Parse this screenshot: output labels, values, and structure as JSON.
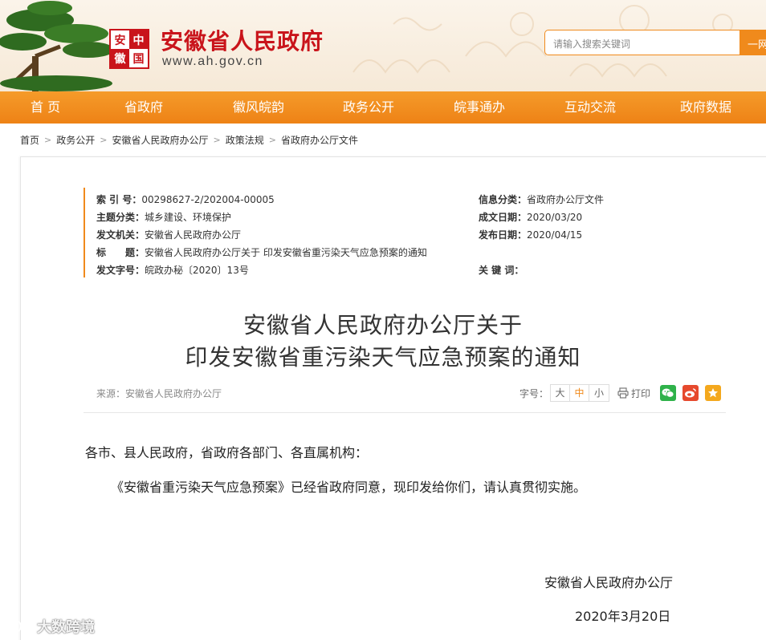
{
  "header": {
    "site_name": "安徽省人民政府",
    "site_domain": "www.ah.gov.cn",
    "seal_chars": [
      "安",
      "中",
      "徽",
      "国"
    ],
    "search_placeholder": "请输入搜索关键词",
    "search_button": "一网",
    "brand_color": "#c9141b",
    "accent_color": "#f08a1c"
  },
  "nav": {
    "items": [
      "首 页",
      "省政府",
      "徽风皖韵",
      "政务公开",
      "皖事通办",
      "互动交流",
      "政府数据"
    ]
  },
  "breadcrumb": [
    "首页",
    "政务公开",
    "安徽省人民政府办公厅",
    "政策法规",
    "省政府办公厅文件"
  ],
  "meta": {
    "index_label": "索 引 号：",
    "index_value": "00298627-2/202004-00005",
    "category_label": "信息分类：",
    "category_value": "省政府办公厅文件",
    "topic_label": "主题分类：",
    "topic_value": "城乡建设、环境保护",
    "created_label": "成文日期：",
    "created_value": "2020/03/20",
    "issuer_label": "发文机关：",
    "issuer_value": "安徽省人民政府办公厅",
    "published_label": "发布日期：",
    "published_value": "2020/04/15",
    "title_label": "标　　题：",
    "title_value": "安徽省人民政府办公厅关于 印发安徽省重污染天气应急预案的通知",
    "docno_label": "发文字号：",
    "docno_value": "皖政办秘〔2020〕13号",
    "keywords_label": "关 键 词："
  },
  "document": {
    "title_line1": "安徽省人民政府办公厅关于",
    "title_line2": "印发安徽省重污染天气应急预案的通知",
    "source": "来源：安徽省人民政府办公厅",
    "fontsize_label": "字号：",
    "font_sizes": [
      "大",
      "中",
      "小"
    ],
    "print_label": "打印",
    "salutation": "各市、县人民政府，省政府各部门、各直属机构：",
    "paragraph1": "《安徽省重污染天气应急预案》已经省政府同意，现印发给你们，请认真贯彻实施。",
    "signature": "安徽省人民政府办公厅",
    "date": "2020年3月20日"
  },
  "watermark": "大数跨境"
}
